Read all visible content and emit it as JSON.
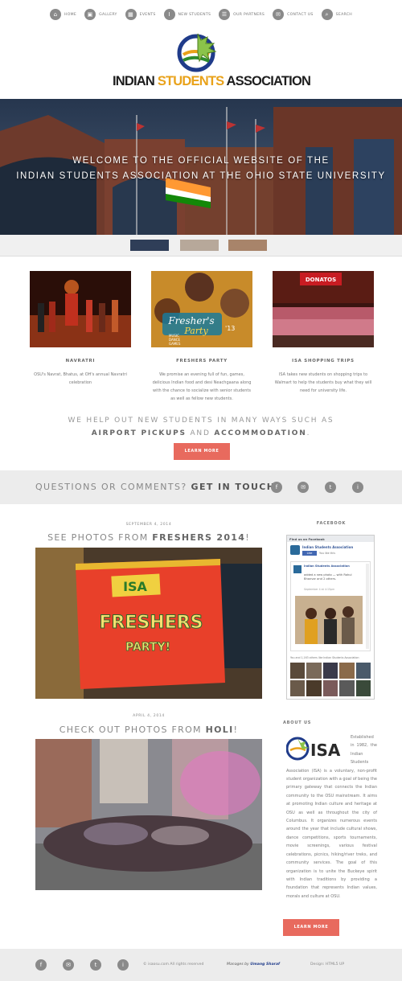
{
  "nav": {
    "items": [
      {
        "label": "Home",
        "icon": "home-icon",
        "glyph": "⌂"
      },
      {
        "label": "Gallery",
        "icon": "gallery-icon",
        "glyph": "▣"
      },
      {
        "label": "Events",
        "icon": "calendar-icon",
        "glyph": "▦"
      },
      {
        "label": "New Students",
        "icon": "info-icon",
        "glyph": "i"
      },
      {
        "label": "Our Partners",
        "icon": "partners-icon",
        "glyph": "☰"
      },
      {
        "label": "Contact Us",
        "icon": "mail-icon",
        "glyph": "✉"
      },
      {
        "label": "Search",
        "icon": "search-icon",
        "glyph": "⌕"
      }
    ]
  },
  "logo": {
    "part1": "INDIAN ",
    "part2": "STUDENTS",
    "part3": " ASSOCIATION"
  },
  "hero": {
    "line1": "Welcome to the official website of the",
    "line2": "Indian Students Association at The Ohio State University"
  },
  "features": [
    {
      "title": "Navratri",
      "text": "OSU's Navrat, Bhatus, at OH's annual Navratri celebration"
    },
    {
      "title": "Freshers Party",
      "text": "We promise an evening full of fun, games, delicious Indian food and desi Neachgaana along with the chance to socialize with senior students as well as fellow new students."
    },
    {
      "title": "ISA Shopping Trips",
      "text": "ISA takes new students on shopping trips to Walmart to help the students buy what they will need for university life."
    }
  ],
  "help": {
    "line1": "We help out new students in many ways such as",
    "line2a": "Airport Pickups",
    "line2b": " and ",
    "line2c": "Accommodation",
    "line2d": "."
  },
  "buttons": {
    "learn_more": "Learn More"
  },
  "contact": {
    "text": "Questions or comments? ",
    "bold": "Get in touch:"
  },
  "social": [
    {
      "icon": "facebook-icon",
      "glyph": "f"
    },
    {
      "icon": "mail-icon",
      "glyph": "✉"
    },
    {
      "icon": "twitter-icon",
      "glyph": "t"
    },
    {
      "icon": "info-icon",
      "glyph": "i"
    }
  ],
  "posts": [
    {
      "date": "September 4, 2014",
      "title_plain": "See photos from ",
      "title_bold": "Freshers 2014",
      "title_end": "!",
      "poster_top": "ISA",
      "poster_mid": "FRESHERS",
      "poster_bot": "PARTY!"
    },
    {
      "date": "April 4, 2014",
      "title_plain": "Check out photos from ",
      "title_bold": "Holi",
      "title_end": "!"
    }
  ],
  "freshers_poster": {
    "line1": "Fresher's",
    "line2": "Party",
    "line3": "'13",
    "sub1": "MUSIC",
    "sub2": "DANCE",
    "sub3": "GAMES"
  },
  "donatos": "DONATOS",
  "sidebar": {
    "facebook_heading": "Facebook",
    "fb_bar": "Find us on Facebook",
    "fb_page": "Indian Students Association",
    "fb_like": "Like",
    "fb_likes_count": "You like this",
    "fb_post_name": "Indian Students Association",
    "fb_post_text": "added a new photo — with Rahul Bhanvar and 2 others.",
    "fb_post_time": "September 4 at 4:15pm",
    "fb_footer": "You and 1,163 others like Indian Students Association",
    "about_heading": "About Us",
    "about_logo": "ISA",
    "about_text": "Established in 1982, the Indian Students Association (ISA) is a voluntary, non-profit student organization with a goal of being the primary gateway that connects the Indian community to the OSU mainstream. It aims at promoting Indian culture and heritage at OSU as well as throughout the city of Columbus. It organizes numerous events around the year that include cultural shows, dance competitions, sports tournaments, movie screenings, various festival celebrations, picnics, hiking/river treks, and community services. The goal of this organization is to unite the Buckeye spirit with Indian traditions by providing a foundation that represents Indian values, morals and culture at OSU."
  },
  "footer": {
    "copyright": "© isaosu.com All rights reserved",
    "managed": "Manages by",
    "manager": "Umang Sharaf",
    "design": "Design: HTML5 UP"
  },
  "colors": {
    "accent": "#e86a5e",
    "icon_gray": "#8a8a8a",
    "band_gray": "#ececec",
    "logo_yellow": "#e9a21a"
  }
}
